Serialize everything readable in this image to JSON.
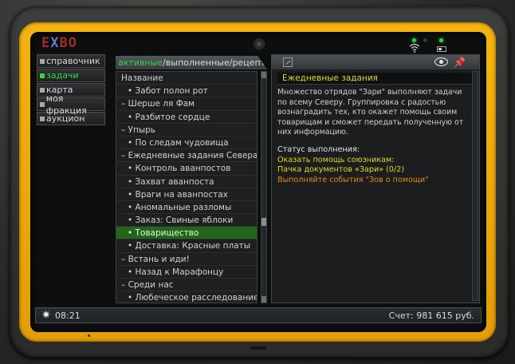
{
  "brand": {
    "logo_part1": "E",
    "logo_part2": "X",
    "logo_part3": "BO"
  },
  "nav": {
    "items": [
      {
        "label": "справочник",
        "active": false
      },
      {
        "label": "задачи",
        "active": true
      },
      {
        "label": "карта",
        "active": false
      },
      {
        "label": "моя фракция",
        "active": false
      },
      {
        "label": "аукцион",
        "active": false
      }
    ]
  },
  "list": {
    "tabs": {
      "active": "активные",
      "sep1": "/",
      "second": "выполненные",
      "sep2": "/",
      "third": "рецепты"
    },
    "rows": [
      {
        "text": "Название",
        "kind": "header"
      },
      {
        "text": "• Забот полон рот",
        "kind": "item"
      },
      {
        "text": "– Шерше ля Фам",
        "kind": "cat"
      },
      {
        "text": "• Разбитое сердце",
        "kind": "item"
      },
      {
        "text": "– Упырь",
        "kind": "cat"
      },
      {
        "text": "• По следам чудовища",
        "kind": "item"
      },
      {
        "text": "– Ежедневные задания Севера",
        "kind": "cat"
      },
      {
        "text": "• Контроль аванпостов",
        "kind": "item"
      },
      {
        "text": "• Захват аванпоста",
        "kind": "item"
      },
      {
        "text": "• Враги на аванпостах",
        "kind": "item"
      },
      {
        "text": "• Аномальные разломы",
        "kind": "item"
      },
      {
        "text": "• Заказ: Свиные яблоки",
        "kind": "item"
      },
      {
        "text": "• Товарищество",
        "kind": "item",
        "selected": true
      },
      {
        "text": "• Доставка: Красные платы",
        "kind": "item"
      },
      {
        "text": "– Встань и иди!",
        "kind": "cat"
      },
      {
        "text": "• Назад к Марафонцу",
        "kind": "item"
      },
      {
        "text": "– Среди нас",
        "kind": "cat"
      },
      {
        "text": "• Любеческое расследование",
        "kind": "item"
      }
    ]
  },
  "detail": {
    "title": "Ежедневные задания",
    "description": "Множество отрядов \"Зари\" выполняют задачи по всему Северу. Группировка с радостью вознаградить тех, кто окажет помощь своим товарищам и сможет передать полученную от них информацию.",
    "status_label": "Статус выполнения:",
    "status_line1": "Оказать помощь союзникам:",
    "status_line2": "Пачка документов «Зари» (0/2)",
    "status_line3": "Выполняйте события \"Зов о помощи\"",
    "icons": {
      "map": "map-icon",
      "eye": "eye-icon",
      "pin": "pin-icon"
    }
  },
  "statusbar": {
    "time_icon": "✷",
    "time": "08:21",
    "balance": "Счет: 981 615 руб."
  },
  "colors": {
    "frame": "#f0ad0c",
    "active_green": "#39d24a",
    "selected_row": "#23661b",
    "title_yellow": "#e6d61e",
    "warn_orange": "#e08a19"
  }
}
